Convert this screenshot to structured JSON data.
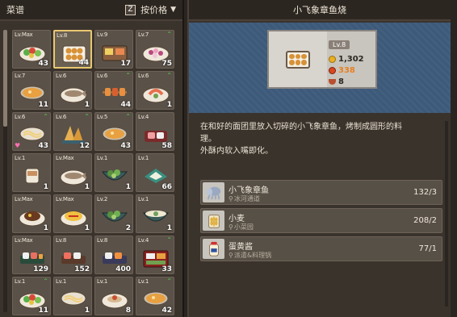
{
  "left": {
    "title": "菜谱",
    "sort_key": "Z",
    "sort_label": "按价格",
    "sort_caret": "▼"
  },
  "cards": [
    {
      "lv": "Lv.Max",
      "count": "43",
      "up": false,
      "heart": false,
      "food": "salad",
      "selected": false
    },
    {
      "lv": "Lv.8",
      "count": "44",
      "up": false,
      "heart": false,
      "food": "takoyaki",
      "selected": true
    },
    {
      "lv": "Lv.9",
      "count": "17",
      "up": false,
      "heart": false,
      "food": "tray",
      "selected": false
    },
    {
      "lv": "Lv.7",
      "count": "75",
      "up": true,
      "heart": false,
      "food": "berries",
      "selected": false
    },
    {
      "lv": "Lv.7",
      "count": "11",
      "up": false,
      "heart": false,
      "food": "soup",
      "selected": false
    },
    {
      "lv": "Lv.6",
      "count": "1",
      "up": false,
      "heart": false,
      "food": "fish",
      "selected": false
    },
    {
      "lv": "Lv.6",
      "count": "44",
      "up": true,
      "heart": false,
      "food": "skewer",
      "selected": false
    },
    {
      "lv": "Lv.6",
      "count": "1",
      "up": true,
      "heart": false,
      "food": "shrimp",
      "selected": false
    },
    {
      "lv": "Lv.6",
      "count": "43",
      "up": true,
      "heart": true,
      "food": "noodle",
      "selected": false
    },
    {
      "lv": "Lv.6",
      "count": "12",
      "up": true,
      "heart": false,
      "food": "tempura",
      "selected": false
    },
    {
      "lv": "Lv.5",
      "count": "43",
      "up": true,
      "heart": false,
      "food": "soup",
      "selected": false
    },
    {
      "lv": "Lv.4",
      "count": "58",
      "up": false,
      "heart": false,
      "food": "sashimi",
      "selected": false
    },
    {
      "lv": "Lv.1",
      "count": "1",
      "up": false,
      "heart": false,
      "food": "cup",
      "selected": false
    },
    {
      "lv": "Lv.Max",
      "count": "1",
      "up": false,
      "heart": false,
      "food": "fish",
      "selected": false
    },
    {
      "lv": "Lv.1",
      "count": "1",
      "up": false,
      "heart": false,
      "food": "greens",
      "selected": false
    },
    {
      "lv": "Lv.1",
      "count": "66",
      "up": false,
      "heart": false,
      "food": "teal",
      "selected": false
    },
    {
      "lv": "Lv.Max",
      "count": "1",
      "up": false,
      "heart": false,
      "food": "meat",
      "selected": false
    },
    {
      "lv": "Lv.Max",
      "count": "1",
      "up": false,
      "heart": false,
      "food": "omelet",
      "selected": false
    },
    {
      "lv": "Lv.2",
      "count": "2",
      "up": false,
      "heart": false,
      "food": "greens",
      "selected": false
    },
    {
      "lv": "Lv.1",
      "count": "1",
      "up": false,
      "heart": false,
      "food": "bowl",
      "selected": false
    },
    {
      "lv": "Lv.Max",
      "count": "129",
      "up": false,
      "heart": false,
      "food": "sushi",
      "selected": false
    },
    {
      "lv": "Lv.8",
      "count": "152",
      "up": false,
      "heart": false,
      "food": "sushi2",
      "selected": false
    },
    {
      "lv": "Lv.8",
      "count": "400",
      "up": false,
      "heart": false,
      "food": "sushi3",
      "selected": false
    },
    {
      "lv": "Lv.4",
      "count": "33",
      "up": true,
      "heart": false,
      "food": "bento",
      "selected": false
    },
    {
      "lv": "Lv.1",
      "count": "11",
      "up": true,
      "heart": false,
      "food": "salad",
      "selected": false
    },
    {
      "lv": "Lv.1",
      "count": "1",
      "up": false,
      "heart": false,
      "food": "noodle",
      "selected": false
    },
    {
      "lv": "Lv.1",
      "count": "8",
      "up": false,
      "heart": false,
      "food": "plate",
      "selected": false
    },
    {
      "lv": "Lv.1",
      "count": "42",
      "up": true,
      "heart": false,
      "food": "soup",
      "selected": false
    }
  ],
  "detail": {
    "title": "小飞象章鱼烧",
    "level": "Lv.8",
    "price": "1,302",
    "energy": "338",
    "quantity": "8",
    "description_line1": "在和好的面团里放入切碎的小飞象章鱼，烤制成圆形的料",
    "description_line2": "理。",
    "description_line3": "外酥内软入嘴即化。",
    "ingredients": [
      {
        "name": "小飞象章鱼",
        "location": "冰河通道",
        "count": "132/3",
        "icon": "octopus"
      },
      {
        "name": "小麦",
        "location": "小菜园",
        "count": "208/2",
        "icon": "wheat"
      },
      {
        "name": "蛋黄酱",
        "location": "派遣&料理锅",
        "count": "77/1",
        "icon": "mayo"
      }
    ]
  },
  "colors": {
    "panel": "#3a332c",
    "banner": "#3d5a7a",
    "selected_border": "#e8c870",
    "up_arrow": "#4ed04e",
    "energy_text": "#e88020"
  }
}
